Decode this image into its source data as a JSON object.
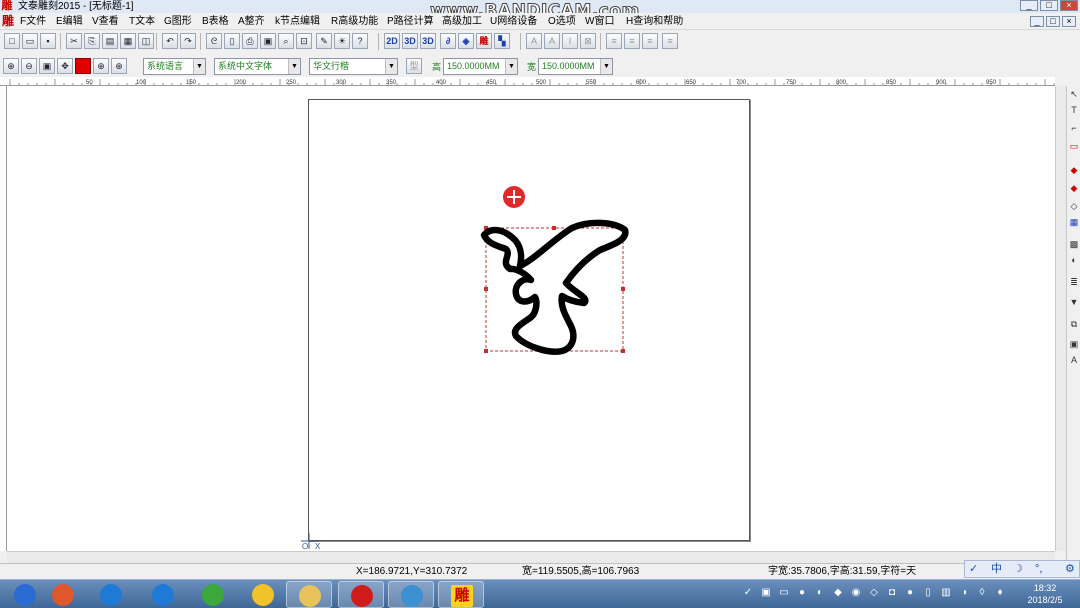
{
  "window": {
    "title": "文泰雕刻2015 - [无标题-1]",
    "logo_char": "雕",
    "controls": [
      "_",
      "□",
      "×"
    ],
    "watermark": "www.BANDICAM.com"
  },
  "menubar": {
    "logo_char": "雕",
    "items": [
      "F文件",
      "E编辑",
      "V查看",
      "T文本",
      "G图形",
      "B表格",
      "A整齐",
      "k节点编辑",
      "R高级功能",
      "P路径计算",
      "高级加工",
      "U网络设备",
      "O选项",
      "W窗口",
      "H查询和帮助"
    ],
    "controls": [
      "_",
      "□",
      "×"
    ]
  },
  "toolbar1": {
    "buttons": [
      {
        "icon": "new-file-icon",
        "glyph": "□"
      },
      {
        "icon": "open-folder-icon",
        "glyph": "▭"
      },
      {
        "icon": "save-icon",
        "glyph": "▪"
      },
      {
        "icon": "cut-icon",
        "glyph": "✂"
      },
      {
        "icon": "copy-icon",
        "glyph": "⎘"
      },
      {
        "icon": "paste-icon",
        "glyph": "▤"
      },
      {
        "icon": "print-preview-icon",
        "glyph": "▦"
      },
      {
        "icon": "disabled-tool-icon",
        "glyph": "◫"
      },
      {
        "icon": "undo-icon",
        "glyph": "↶"
      },
      {
        "icon": "redo-icon",
        "glyph": "↷"
      },
      {
        "icon": "path-tool-icon",
        "glyph": "ᘓ"
      },
      {
        "icon": "page-tool-icon",
        "glyph": "▯"
      },
      {
        "icon": "printer-icon",
        "glyph": "⎙"
      },
      {
        "icon": "scanner-icon",
        "glyph": "▣"
      },
      {
        "icon": "find-icon",
        "glyph": "⌕"
      },
      {
        "icon": "frame-icon",
        "glyph": "⊡"
      },
      {
        "icon": "pen-icon",
        "glyph": "✎"
      },
      {
        "icon": "bulb-icon",
        "glyph": "☀"
      },
      {
        "icon": "help-icon",
        "glyph": "?"
      },
      {
        "icon": "2d-icon",
        "glyph": "2D"
      },
      {
        "icon": "3d-icon",
        "glyph": "3D"
      },
      {
        "icon": "3d-view-icon",
        "glyph": "3D"
      },
      {
        "icon": "engrave-icon",
        "glyph": "∂"
      },
      {
        "icon": "diamond-icon",
        "glyph": "◈"
      },
      {
        "icon": "carve-icon",
        "glyph": "雕"
      },
      {
        "icon": "color-grid-icon",
        "glyph": "▚"
      },
      {
        "icon": "shape-text-icon",
        "glyph": "A"
      },
      {
        "icon": "text-frame-icon",
        "glyph": "A"
      },
      {
        "icon": "italic-icon",
        "glyph": "I"
      },
      {
        "icon": "text-box-icon",
        "glyph": "⊠"
      },
      {
        "icon": "align-left-icon",
        "glyph": "≡"
      },
      {
        "icon": "align-center-icon",
        "glyph": "≡"
      },
      {
        "icon": "align-right-icon",
        "glyph": "≡"
      },
      {
        "icon": "justify-icon",
        "glyph": "≡"
      }
    ]
  },
  "toolbar2": {
    "buttons": [
      {
        "icon": "zoom-in-icon",
        "glyph": "⊕"
      },
      {
        "icon": "zoom-out-icon",
        "glyph": "⊖"
      },
      {
        "icon": "zoom-page-icon",
        "glyph": "▣"
      },
      {
        "icon": "pan-icon",
        "glyph": "✥"
      },
      {
        "icon": "color-swatch-icon",
        "glyph": ""
      },
      {
        "icon": "zoom-fit-icon",
        "glyph": "⊕"
      },
      {
        "icon": "zoom-select-icon",
        "glyph": "⊕"
      }
    ],
    "language_combo": "系统语言",
    "font_combo": "系统中文字体",
    "style_combo": "华文行楷",
    "height_label": "高",
    "height_value": "150.0000MM",
    "width_label": "宽",
    "width_value": "150.0000MM",
    "aux_glyph": "型"
  },
  "ruler": {
    "labels": [
      "50",
      "100",
      "150",
      "200",
      "250",
      "300",
      "350",
      "400",
      "450",
      "500",
      "550",
      "600",
      "650",
      "700",
      "750",
      "800",
      "850",
      "900",
      "950"
    ]
  },
  "right_toolbar": {
    "tools": [
      "selection-arrow-icon",
      "text-tool-icon",
      "node-tool-icon",
      "rectangle-tool-icon",
      "fill-tool-icon",
      "gradient-tool-icon",
      "shapes-tool-icon",
      "table-tool-icon",
      "color-grid-tool-icon",
      "map-tool-icon",
      "list-tool-icon",
      "stamp-tool-icon",
      "copy-tool-icon",
      "image-tool-icon",
      "text-path-tool-icon"
    ],
    "glyphs": [
      "↖",
      "T",
      "⌐",
      "▭",
      "◆",
      "◆",
      "◇",
      "▦",
      "▩",
      "◐",
      "≣",
      "▼",
      "⧉",
      "▣",
      "A"
    ]
  },
  "status": {
    "coords": "X=186.9721,Y=310.7372",
    "size": "宽=119.5505,高=106.7963",
    "char_info": "字宽:35.7806,字高:31.59,字符=天"
  },
  "ime": {
    "items": [
      "✓",
      "中",
      "☽",
      "°,",
      "⚙"
    ]
  },
  "taskbar": {
    "clock_time": "18:32",
    "clock_date": "2018/2/5",
    "tasks": [
      {
        "name": "start-button",
        "color": "#2a6bd1"
      },
      {
        "name": "task-app-colorful",
        "color": "#e0572e"
      },
      {
        "name": "task-ie-browser",
        "color": "#1f7ad6"
      },
      {
        "name": "task-ie-browser-2",
        "color": "#1f7ad6"
      },
      {
        "name": "task-360-browser",
        "color": "#3aa83a"
      },
      {
        "name": "task-qq-music",
        "color": "#f2c22a"
      },
      {
        "name": "task-file-explorer",
        "color": "#e8c35a"
      },
      {
        "name": "task-recorder",
        "color": "#d11b1b"
      },
      {
        "name": "task-chat-app",
        "color": "#3c8fd1"
      },
      {
        "name": "task-wentai-engrave",
        "color": "#c00000"
      }
    ],
    "tray": [
      "✓",
      "▣",
      "▭",
      "●",
      "◐",
      "◆",
      "◉",
      "◇",
      "◘",
      "●",
      "▯",
      "▥",
      "◑",
      "◊",
      "♦"
    ],
    "task_engrave_glyph": "雕"
  }
}
